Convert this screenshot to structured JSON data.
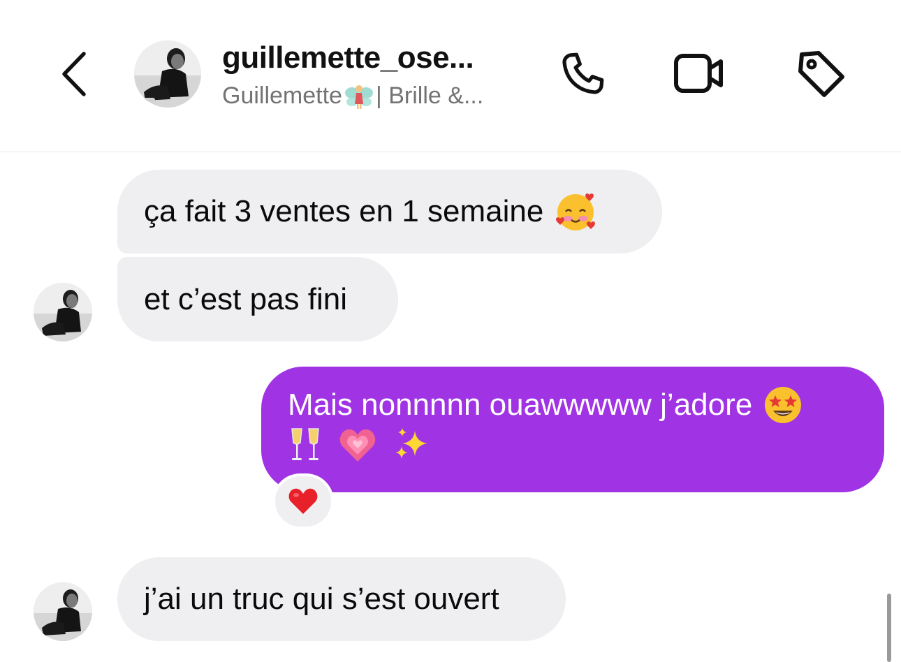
{
  "header": {
    "username": "guillemette_ose...",
    "subtitle_before": "Guillemette",
    "subtitle_after": "| Brille &...",
    "subtitle_emoji": "fairy-emoji",
    "icons": [
      "back-chevron-icon",
      "phone-icon",
      "video-camera-icon",
      "tag-icon"
    ]
  },
  "messages": [
    {
      "direction": "incoming",
      "text": "ça fait 3 ventes en 1 semaine",
      "emoji": "smiling-face-with-hearts"
    },
    {
      "direction": "incoming",
      "text": "et c’est pas fini"
    },
    {
      "direction": "outgoing",
      "text": "Mais nonnnnn ouawwwww j’adore",
      "emoji": [
        "star-struck",
        "clinking-glasses",
        "growing-heart",
        "sparkles"
      ],
      "reaction": "red-heart"
    },
    {
      "direction": "incoming",
      "text": "j’ai un truc qui s’est ouvert"
    }
  ],
  "colors": {
    "outgoing_bubble": "#a033e3",
    "incoming_bubble": "#efeff1",
    "subtitle": "#737373"
  }
}
